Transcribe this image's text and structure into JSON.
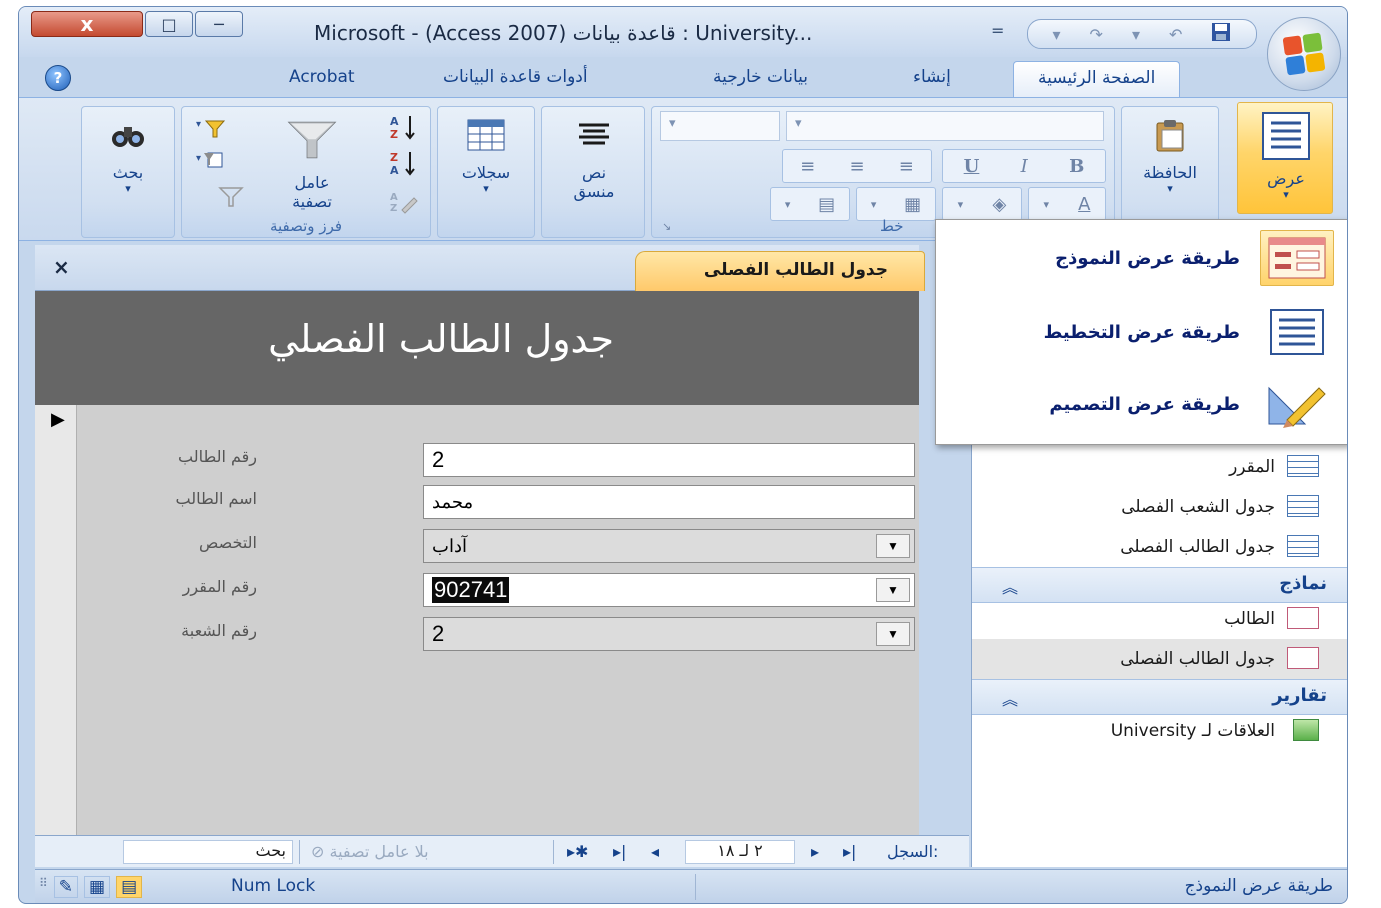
{
  "window": {
    "title": "Microsoft - (Access 2007) قاعدة بيانات : University...",
    "qat_dropdown": "=",
    "close_glyph": "x",
    "max_glyph": "□",
    "min_glyph": "─"
  },
  "ribbon_tabs": [
    "Acrobat",
    "أدوات قاعدة البيانات",
    "بيانات خارجية",
    "إنشاء",
    "الصفحة الرئيسية"
  ],
  "ribbon": {
    "find_label": "بحث",
    "filter_label_1": "عامل",
    "filter_label_2": "تصفية",
    "sort_filter_group": "فرز وتصفية",
    "records_label": "سجلات",
    "rich_text_label_1": "نص",
    "rich_text_label_2": "منسق",
    "font_group_partial": "خط",
    "clipboard_label": "الحافظة",
    "view_label": "عرض"
  },
  "view_menu": {
    "items": [
      "طريقة عرض النموذج",
      "طريقة عرض التخطيط",
      "طريقة عرض التصميم"
    ]
  },
  "document": {
    "tab_title": "جدول الطالب الفصلى",
    "close_glyph": "×"
  },
  "form": {
    "title": "جدول الطالب الفصلي",
    "fields": [
      {
        "label": "رقم الطالب",
        "value": "2"
      },
      {
        "label": "اسم الطالب",
        "value": "محمد"
      },
      {
        "label": "التخصص",
        "value": "آداب"
      },
      {
        "label": "رقم المقرر",
        "value": "902741"
      },
      {
        "label": "رقم الشعبة",
        "value": "2"
      }
    ]
  },
  "record_nav": {
    "record_label": "السجل:",
    "position": "٢ لـ ١٨",
    "no_filter": "بلا عامل تصفية",
    "search": "بحث"
  },
  "nav_pane": {
    "tables": [
      "المقرر",
      "جدول الشعب الفصلى",
      "جدول الطالب الفصلى"
    ],
    "forms_group": "نماذج",
    "forms": [
      "الطالب",
      "جدول الطالب الفصلى"
    ],
    "reports_group": "تقارير",
    "reports": [
      "العلاقات لـ University"
    ]
  },
  "status_bar": {
    "view_name": "طريقة عرض النموذج",
    "num_lock": "Num Lock"
  },
  "colors": {
    "ribbon_bg": "#c9d9ee",
    "active_tab_accent": "#ffc96b",
    "form_header": "#666666",
    "form_detail": "#cfcfcf",
    "nav_group_text": "#15428b"
  }
}
